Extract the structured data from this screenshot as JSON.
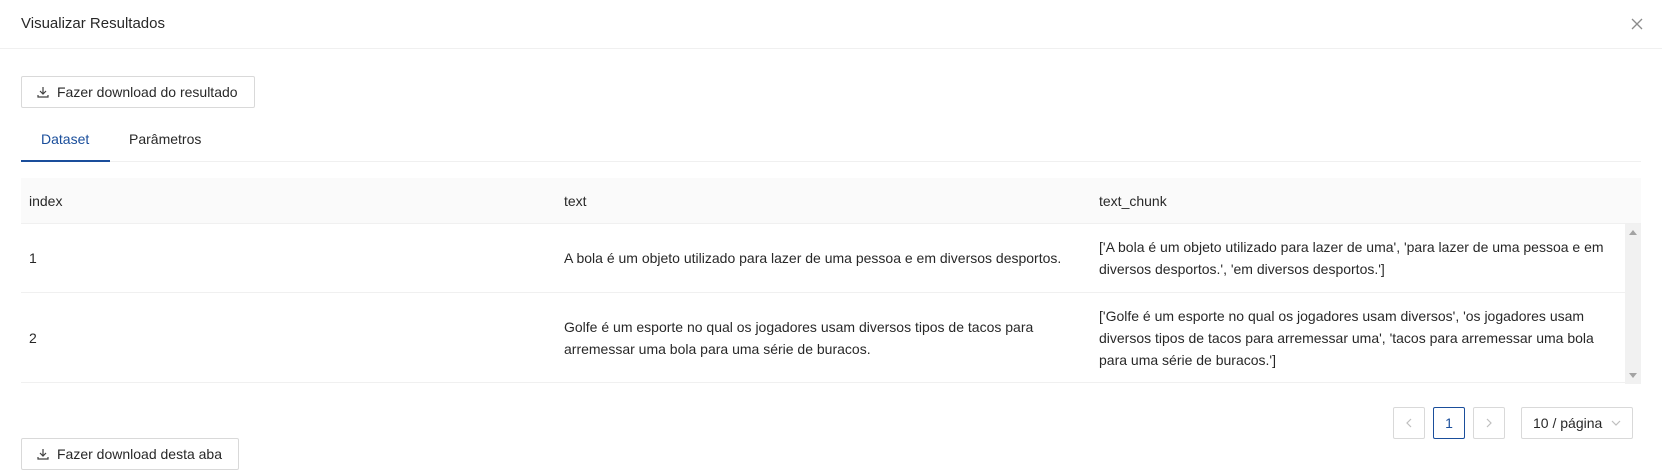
{
  "modal": {
    "title": "Visualizar Resultados"
  },
  "toolbar": {
    "download_result_label": "Fazer download do resultado"
  },
  "tabs": [
    {
      "label": "Dataset",
      "active": true
    },
    {
      "label": "Parâmetros",
      "active": false
    }
  ],
  "table": {
    "columns": [
      "index",
      "text",
      "text_chunk"
    ],
    "rows": [
      {
        "index": "1",
        "text": "A bola é um objeto utilizado para lazer de uma pessoa e em diversos desportos.",
        "text_chunk": "['A bola é um objeto utilizado para lazer de uma', 'para lazer de uma pessoa e em diversos desportos.', 'em diversos desportos.']"
      },
      {
        "index": "2",
        "text": "Golfe é um esporte no qual os jogadores usam diversos tipos de tacos para arremessar uma bola para uma série de buracos.",
        "text_chunk": "['Golfe é um esporte no qual os jogadores usam diversos', 'os jogadores usam diversos tipos de tacos para arremessar uma', 'tacos para arremessar uma bola para uma série de buracos.']"
      }
    ]
  },
  "pagination": {
    "current_page": "1",
    "page_size_label": "10 / página"
  },
  "footer": {
    "download_tab_label": "Fazer download desta aba"
  },
  "colors": {
    "accent": "#1a4e9b",
    "border": "#d9d9d9",
    "header_bg": "#fafafa"
  },
  "icons": {
    "close": "close-icon",
    "download": "download-icon",
    "prev": "chevron-left-icon",
    "next": "chevron-right-icon",
    "dropdown": "chevron-down-icon"
  }
}
